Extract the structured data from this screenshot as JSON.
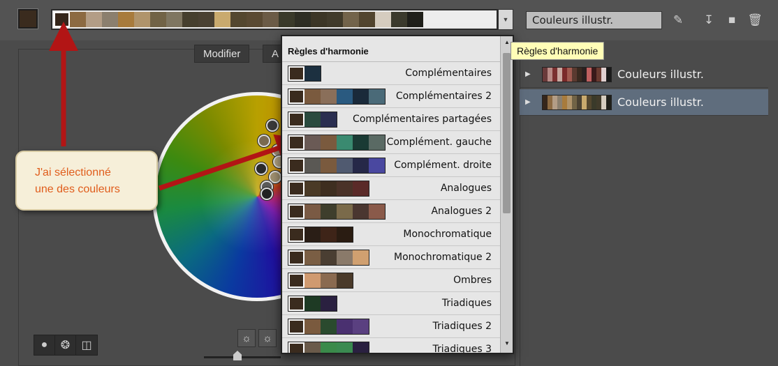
{
  "toolbar": {
    "base_color": "#3a2b1e",
    "strip_colors": [
      "#35261b",
      "#8c6a42",
      "#b39d86",
      "#8b7f6e",
      "#a87b3c",
      "#b0946b",
      "#716346",
      "#7f7661",
      "#463f2e",
      "#4a4132",
      "#c9aa6e",
      "#54472f",
      "#5a4a33",
      "#6b5b46",
      "#3a3a2a",
      "#2e2e24",
      "#3c3626",
      "#413b2b",
      "#73644b",
      "#52452f",
      "#d5ccbf",
      "#3b3a2d",
      "#1f1f1a"
    ],
    "selected_index": 0,
    "name_value": "Couleurs illustr.",
    "tools": [
      {
        "name": "eyedropper-icon",
        "glyph": "✒"
      },
      {
        "name": "save-icon",
        "glyph": "⤓"
      },
      {
        "name": "folder-icon",
        "glyph": "■"
      },
      {
        "name": "trash-icon",
        "glyph": "✖"
      }
    ]
  },
  "tabs": {
    "modifier": "Modifier",
    "second": "A"
  },
  "harmony": {
    "header": "Règles d'harmonie",
    "tooltip": "Règles d'harmonie",
    "items": [
      {
        "label": "Complémentaires",
        "colors": [
          "#3a2b1e",
          "#1c3040"
        ]
      },
      {
        "label": "Complémentaires 2",
        "colors": [
          "#3a2b1e",
          "#7a5a3e",
          "#8a6f5a",
          "#2a5a80",
          "#1a2a3a",
          "#4a6a78"
        ]
      },
      {
        "label": "Complémentaires partagées",
        "colors": [
          "#3a2b1e",
          "#2a4a3e",
          "#2a2e50"
        ]
      },
      {
        "label": "Complément. gauche",
        "colors": [
          "#3a2b1e",
          "#6a5a55",
          "#7a5a3e",
          "#3a8a70",
          "#1a3a34",
          "#5a6a64"
        ]
      },
      {
        "label": "Complément. droite",
        "colors": [
          "#3a2b1e",
          "#5a5854",
          "#7a5a3e",
          "#505a70",
          "#262848",
          "#4a48a0"
        ]
      },
      {
        "label": "Analogues",
        "colors": [
          "#3a2b1e",
          "#4a3a26",
          "#3e2e20",
          "#4a3228",
          "#5a2a28"
        ]
      },
      {
        "label": "Analogues 2",
        "colors": [
          "#3a2b1e",
          "#7a5a44",
          "#3e3e2c",
          "#7a6a4a",
          "#4a3630",
          "#8a5a4a"
        ]
      },
      {
        "label": "Monochromatique",
        "colors": [
          "#3a2b1e",
          "#2a1e16",
          "#3e2418",
          "#2a1c12"
        ]
      },
      {
        "label": "Monochromatique 2",
        "colors": [
          "#3a2b1e",
          "#7a5e44",
          "#4a3e32",
          "#8a7a6a",
          "#d0a070"
        ]
      },
      {
        "label": "Ombres",
        "colors": [
          "#3a2b1e",
          "#d09a70",
          "#8a6a50",
          "#4a3a2a"
        ]
      },
      {
        "label": "Triadiques",
        "colors": [
          "#3a2b1e",
          "#1e3a24",
          "#2a2040"
        ]
      },
      {
        "label": "Triadiques 2",
        "colors": [
          "#3a2b1e",
          "#7a5a3e",
          "#2a4a2e",
          "#4a3070",
          "#5a4080"
        ]
      },
      {
        "label": "Triadiques 3",
        "colors": [
          "#3a2b1e",
          "#6a5a4a",
          "#3a8a4a",
          "#3a8a50",
          "#2a2040"
        ]
      }
    ]
  },
  "library": {
    "groups": [
      {
        "label": "Couleurs illustr.",
        "selected": false,
        "colors": [
          "#6a3a3a",
          "#b88a86",
          "#7a3030",
          "#c8a8a0",
          "#7a2a2a",
          "#a05a50",
          "#5a3a30",
          "#3a2a20",
          "#2a2020",
          "#c06060",
          "#3a1a1a",
          "#6a3a30",
          "#e0d0d0",
          "#1a1a1a"
        ]
      },
      {
        "label": "Couleurs illustr.",
        "selected": true,
        "colors": [
          "#35261b",
          "#8c6a42",
          "#b39d86",
          "#8b7f6e",
          "#a87b3c",
          "#b0946b",
          "#716346",
          "#4a4132",
          "#c9aa6e",
          "#54472f",
          "#3a3a2a",
          "#413b2b",
          "#d5ccbf",
          "#1f1f1a"
        ]
      }
    ]
  },
  "callout": {
    "line1": "J'ai sélectionné",
    "line2": "une des couleurs"
  },
  "wheel_dots": [
    {
      "color": "#3a3a3a"
    },
    {
      "color": "#7a6a50"
    },
    {
      "color": "#9a8a70"
    },
    {
      "color": "#2a2a2a"
    },
    {
      "color": "#a09070"
    },
    {
      "color": "#5a5a5a"
    },
    {
      "color": "#b0a080"
    },
    {
      "color": "#222222"
    }
  ]
}
